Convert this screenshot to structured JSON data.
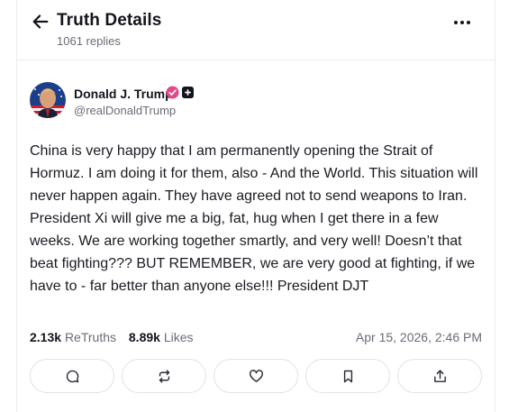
{
  "header": {
    "title": "Truth Details",
    "subtitle": "1061 replies",
    "back_icon": "arrow-left-icon",
    "more_icon": "more-horizontal-icon"
  },
  "post": {
    "author_name": "Donald J. Trump",
    "handle": "@realDonaldTrump",
    "verified_color": "#e5488a",
    "body": "China is very happy that I am permanently opening the Strait of Hormuz. I am doing it for them, also - And the World. This situation will never happen again. They have agreed not to send weapons to Iran. President Xi will give me a big, fat, hug when I get there in a few weeks. We are working together smartly, and very well! Doesn’t that beat fighting??? BUT REMEMBER, we are very good at fighting, if we have to - far better than anyone else!!! President DJT",
    "retruths_count": "2.13k",
    "retruths_label": "ReTruths",
    "likes_count": "8.89k",
    "likes_label": "Likes",
    "timestamp": "Apr 15, 2026, 2:46 PM"
  },
  "actions": [
    {
      "icon": "reply-icon"
    },
    {
      "icon": "retruth-icon"
    },
    {
      "icon": "heart-icon"
    },
    {
      "icon": "bookmark-icon"
    },
    {
      "icon": "share-icon"
    }
  ]
}
